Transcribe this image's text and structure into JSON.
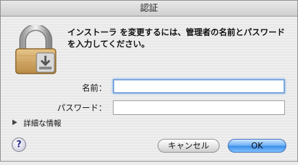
{
  "window": {
    "title": "認証"
  },
  "message": {
    "line1": "インストーラ を変更するには、管理者の名前とパスワード",
    "line2": "を入力してください。"
  },
  "form": {
    "name_label": "名前：",
    "name_value": "",
    "password_label": "パスワード：",
    "password_value": ""
  },
  "details": {
    "label": "詳細な情報"
  },
  "buttons": {
    "help_label": "?",
    "cancel_label": "キャンセル",
    "ok_label": "OK"
  },
  "icons": {
    "lock": "lock-icon",
    "disclosure": "disclosure-triangle-icon"
  },
  "colors": {
    "default_button": "#3b8de8",
    "focus_ring": "#7aa6dd"
  }
}
